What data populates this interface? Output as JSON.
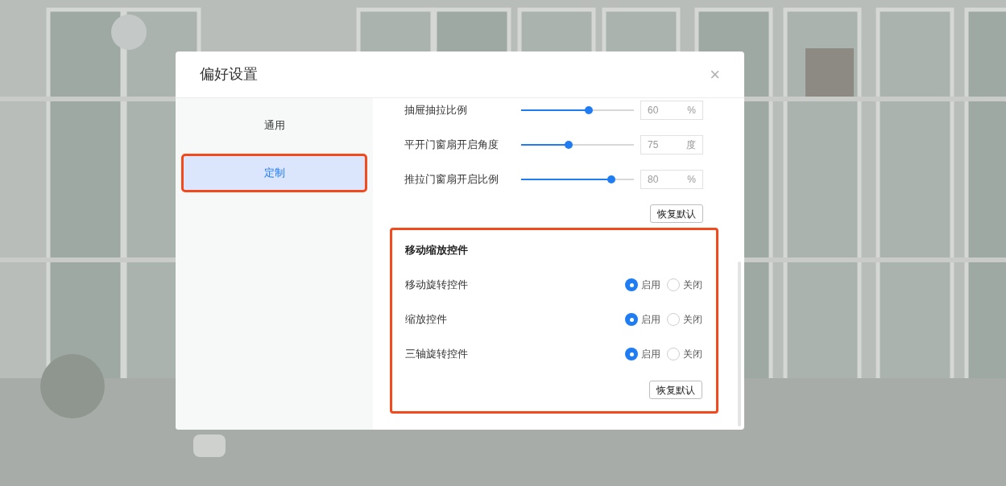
{
  "dialog": {
    "title": "偏好设置",
    "close": "×"
  },
  "sidebar": {
    "items": [
      {
        "label": "通用",
        "selected": false,
        "highlighted": false
      },
      {
        "label": "定制",
        "selected": true,
        "highlighted": true
      }
    ]
  },
  "sliders": [
    {
      "label": "抽屉抽拉比例",
      "level": 0.6,
      "value": "60",
      "unit": "%"
    },
    {
      "label": "平开门窗扇开启角度",
      "level": 0.42,
      "value": "75",
      "unit": "度"
    },
    {
      "label": "推拉门窗扇开启比例",
      "level": 0.8,
      "value": "80",
      "unit": "%"
    }
  ],
  "sliders_reset": "恢复默认",
  "controls_section": {
    "highlighted": true,
    "title": "移动缩放控件",
    "rows": [
      {
        "label": "移动旋转控件",
        "options": [
          {
            "label": "启用",
            "selected": true
          },
          {
            "label": "关闭",
            "selected": false
          }
        ]
      },
      {
        "label": "缩放控件",
        "options": [
          {
            "label": "启用",
            "selected": true
          },
          {
            "label": "关闭",
            "selected": false
          }
        ]
      },
      {
        "label": "三轴旋转控件",
        "options": [
          {
            "label": "启用",
            "selected": true
          },
          {
            "label": "关闭",
            "selected": false
          }
        ]
      }
    ],
    "reset": "恢复默认"
  }
}
